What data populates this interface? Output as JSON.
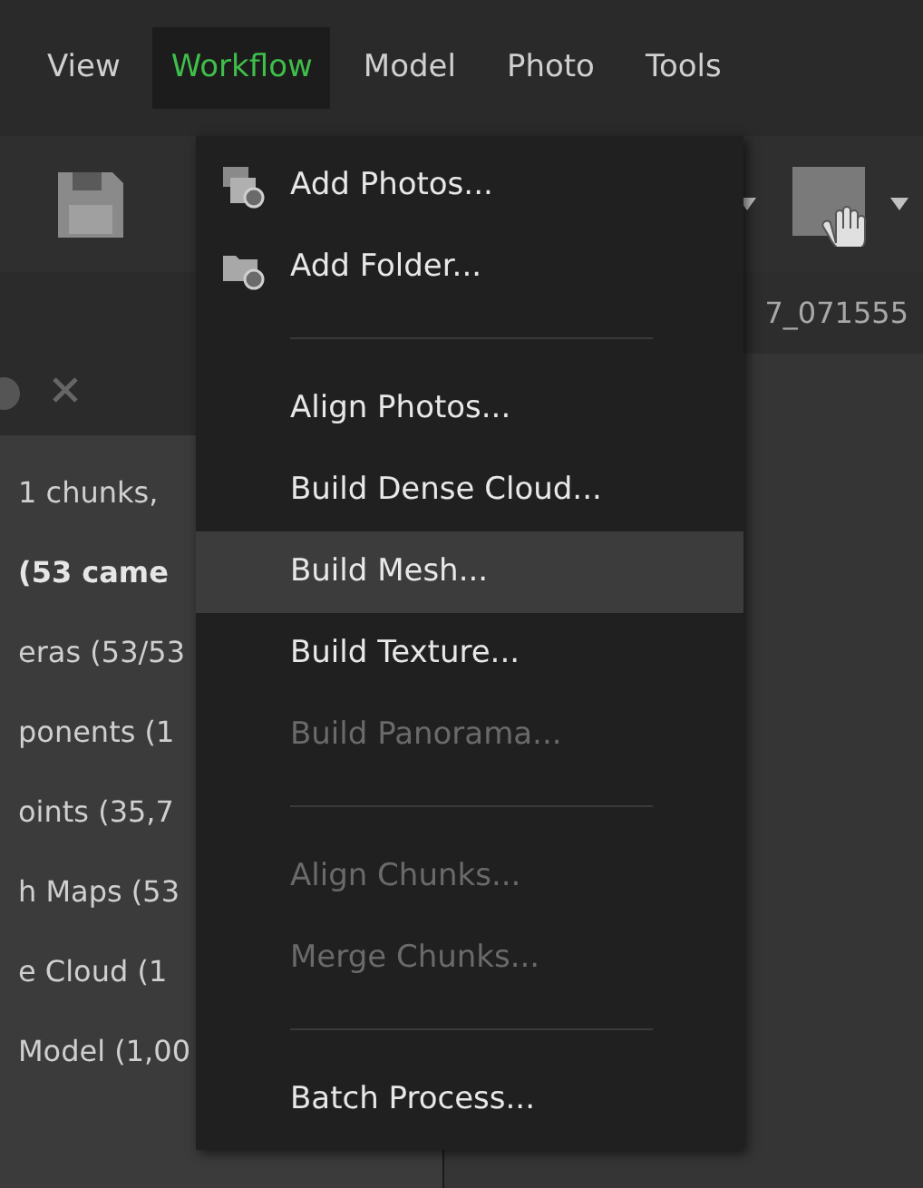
{
  "menu_bar": [
    {
      "label": "View",
      "selected": false
    },
    {
      "label": "Workflow",
      "selected": true
    },
    {
      "label": "Model",
      "selected": false
    },
    {
      "label": "Photo",
      "selected": false
    },
    {
      "label": "Tools",
      "selected": false
    }
  ],
  "tab": {
    "label": "7_071555"
  },
  "workspace": {
    "items": [
      {
        "label": "1 chunks,",
        "bold": false
      },
      {
        "label": "(53 came",
        "bold": true
      },
      {
        "label": "eras (53/53",
        "bold": false
      },
      {
        "label": "ponents (1",
        "bold": false
      },
      {
        "label": "oints (35,7",
        "bold": false
      },
      {
        "label": "h Maps (53",
        "bold": false
      },
      {
        "label": "e Cloud (1",
        "bold": false
      },
      {
        "label": "Model (1,00",
        "bold": false
      }
    ]
  },
  "workflow_menu": [
    {
      "kind": "photos",
      "label": "Add Photos...",
      "disabled": false,
      "selected": false
    },
    {
      "kind": "folder",
      "label": "Add Folder...",
      "disabled": false,
      "selected": false
    },
    {
      "kind": "separator"
    },
    {
      "kind": "item",
      "label": "Align Photos...",
      "disabled": false,
      "selected": false
    },
    {
      "kind": "item",
      "label": "Build Dense Cloud...",
      "disabled": false,
      "selected": false
    },
    {
      "kind": "item",
      "label": "Build Mesh...",
      "disabled": false,
      "selected": true
    },
    {
      "kind": "item",
      "label": "Build Texture...",
      "disabled": false,
      "selected": false
    },
    {
      "kind": "item",
      "label": "Build Panorama...",
      "disabled": true,
      "selected": false
    },
    {
      "kind": "separator"
    },
    {
      "kind": "item",
      "label": "Align Chunks...",
      "disabled": true,
      "selected": false
    },
    {
      "kind": "item",
      "label": "Merge Chunks...",
      "disabled": true,
      "selected": false
    },
    {
      "kind": "separator"
    },
    {
      "kind": "item",
      "label": "Batch Process...",
      "disabled": false,
      "selected": false
    }
  ]
}
